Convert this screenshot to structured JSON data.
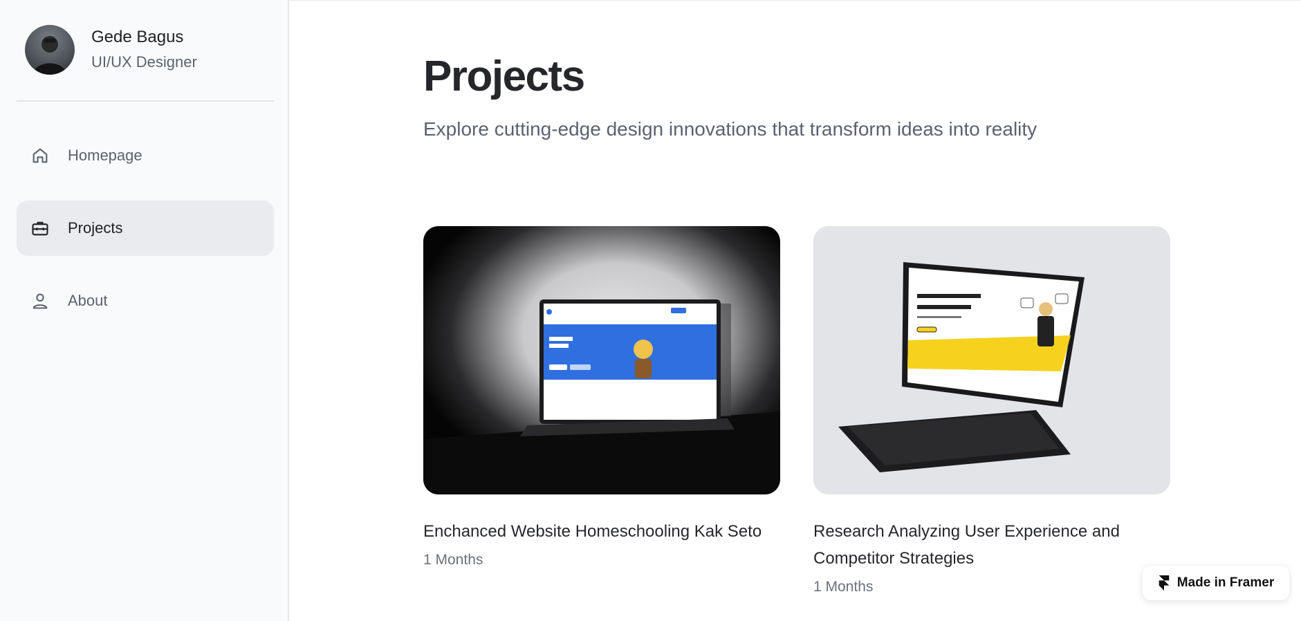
{
  "sidebar": {
    "profile": {
      "name": "Gede Bagus",
      "role": "UI/UX Designer"
    },
    "nav": [
      {
        "label": "Homepage",
        "icon": "home-icon",
        "active": false
      },
      {
        "label": "Projects",
        "icon": "briefcase-icon",
        "active": true
      },
      {
        "label": "About",
        "icon": "user-icon",
        "active": false
      }
    ]
  },
  "main": {
    "title": "Projects",
    "subtitle": "Explore cutting-edge design innovations that transform ideas into reality",
    "projects": [
      {
        "title": "Enchanced Website Homeschooling Kak Seto",
        "duration": "1 Months"
      },
      {
        "title": "Research Analyzing User Experience and Competitor Strategies",
        "duration": "1 Months"
      }
    ]
  },
  "badge": {
    "label": "Made in Framer",
    "icon": "framer-logo-icon"
  },
  "colors": {
    "sidebar_bg": "#f9fafb",
    "active_nav_bg": "#eaebee",
    "text_primary": "#26272b",
    "text_secondary": "#5b6170"
  }
}
